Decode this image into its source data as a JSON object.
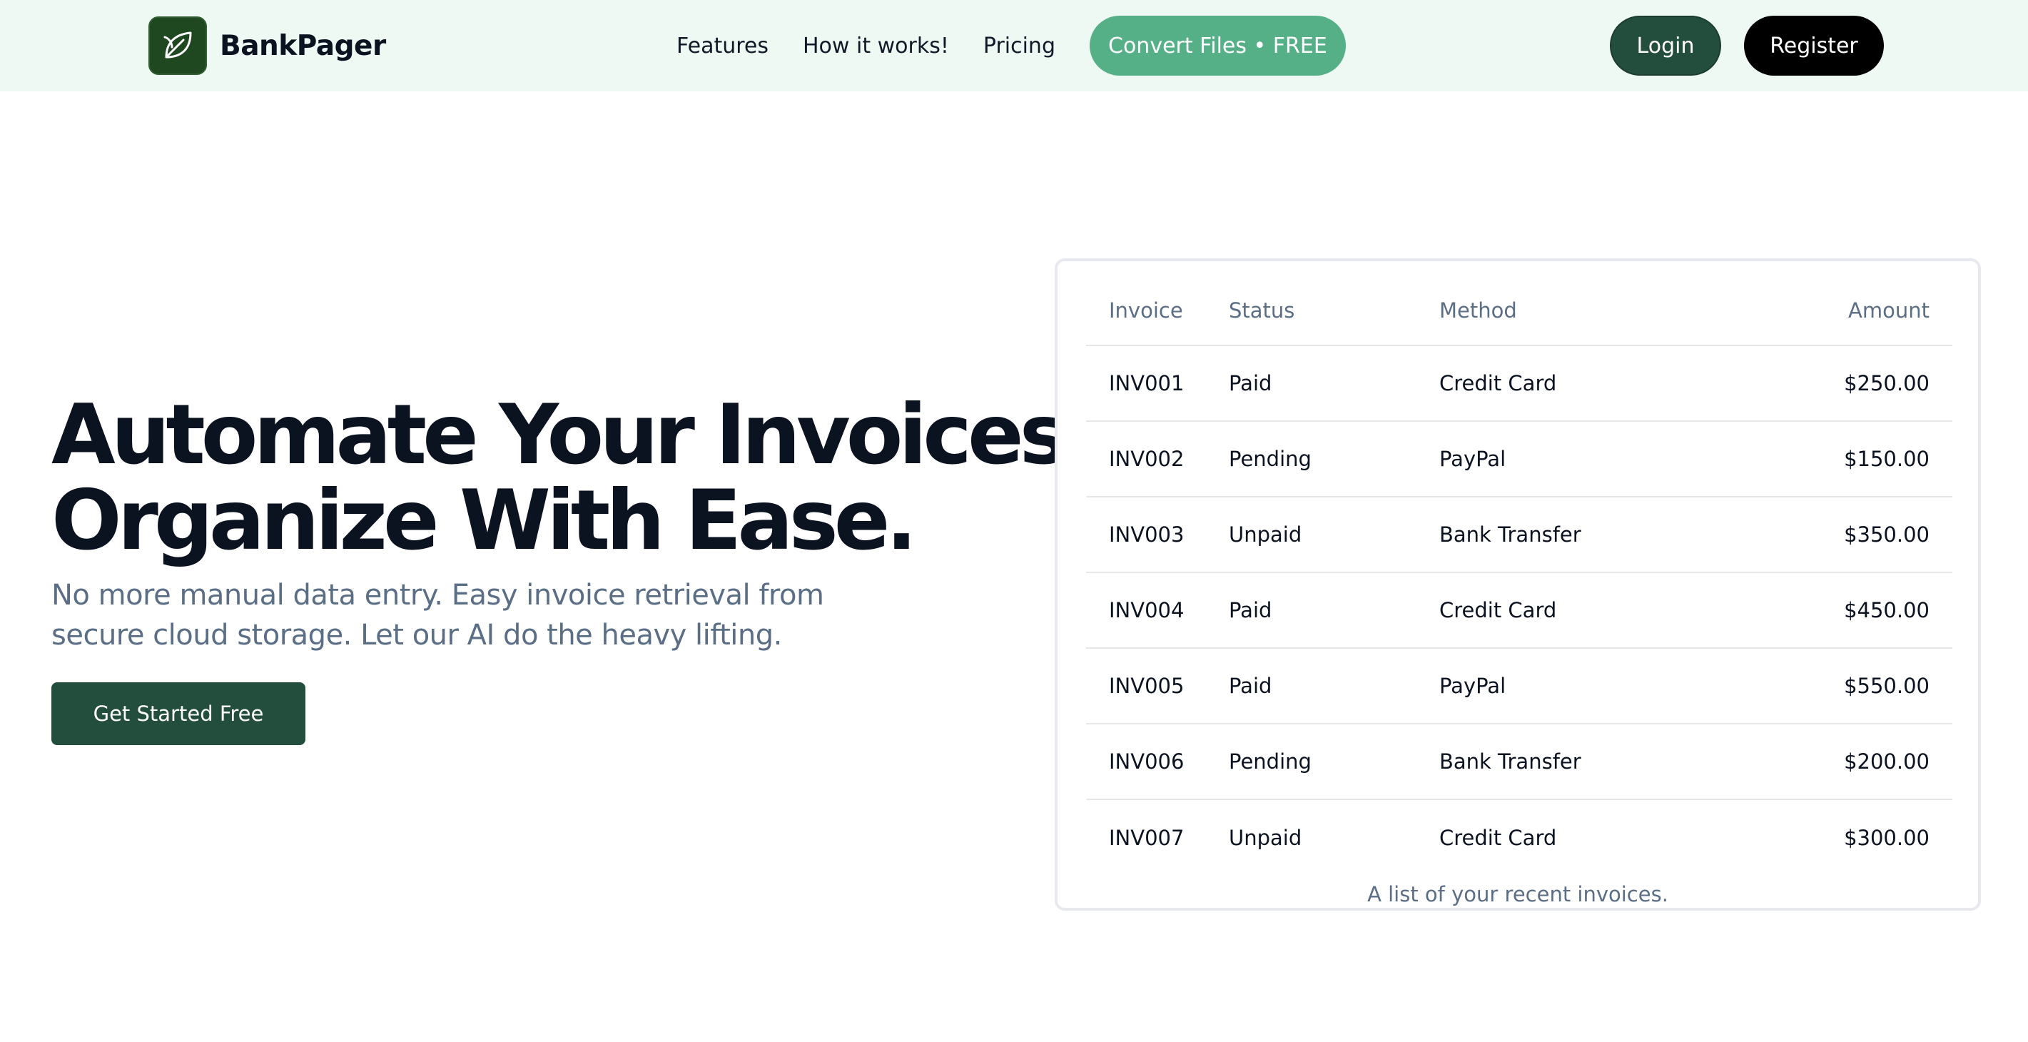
{
  "nav": {
    "brand": "BankPager",
    "links": [
      "Features",
      "How it works!",
      "Pricing"
    ],
    "convert_label": "Convert Files • FREE",
    "login_label": "Login",
    "register_label": "Register"
  },
  "hero": {
    "headline_line1": "Automate Your Invoices.",
    "headline_line2": "Organize With Ease.",
    "subtext": "No more manual data entry. Easy invoice retrieval from secure cloud storage. Let our AI do the heavy lifting.",
    "cta_label": "Get Started Free"
  },
  "table": {
    "headers": [
      "Invoice",
      "Status",
      "Method",
      "Amount"
    ],
    "rows": [
      [
        "INV001",
        "Paid",
        "Credit Card",
        "$250.00"
      ],
      [
        "INV002",
        "Pending",
        "PayPal",
        "$150.00"
      ],
      [
        "INV003",
        "Unpaid",
        "Bank Transfer",
        "$350.00"
      ],
      [
        "INV004",
        "Paid",
        "Credit Card",
        "$450.00"
      ],
      [
        "INV005",
        "Paid",
        "PayPal",
        "$550.00"
      ],
      [
        "INV006",
        "Pending",
        "Bank Transfer",
        "$200.00"
      ],
      [
        "INV007",
        "Unpaid",
        "Credit Card",
        "$300.00"
      ]
    ],
    "caption": "A list of your recent invoices."
  },
  "colors": {
    "nav_bg": "#eff9f3",
    "brand_green": "#234d3c",
    "accent_green": "#56b087",
    "muted_text": "#5a6e86"
  },
  "icons": {
    "logo": "leaf-icon"
  }
}
